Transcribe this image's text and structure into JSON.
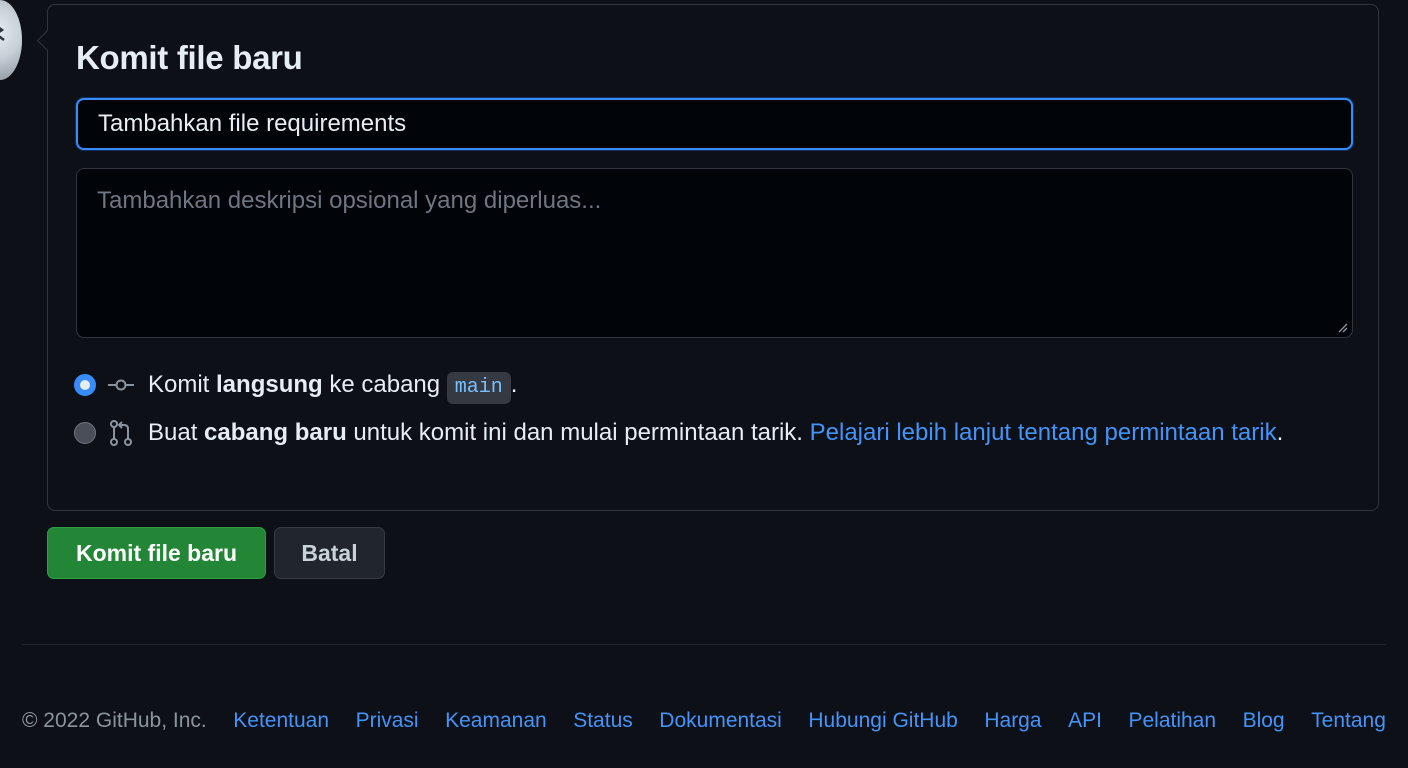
{
  "commit_form": {
    "heading": "Komit file baru",
    "summary_value": "Tambahkan file requirements",
    "description_placeholder": "Tambahkan deskripsi opsional yang diperluas...",
    "option_direct": {
      "prefix": "Komit ",
      "bold": "langsung",
      "middle": " ke cabang ",
      "branch": "main",
      "suffix": ".",
      "icon": "git-commit-icon",
      "selected": true
    },
    "option_new_branch": {
      "prefix": "Buat ",
      "bold": "cabang baru",
      "middle": " untuk komit ini dan mulai permintaan tarik. ",
      "link": "Pelajari lebih lanjut tentang permintaan tarik",
      "suffix": ".",
      "icon": "git-pull-request-icon",
      "selected": false
    }
  },
  "actions": {
    "commit_label": "Komit file baru",
    "cancel_label": "Batal"
  },
  "footer": {
    "copyright": "© 2022 GitHub, Inc.",
    "links": [
      "Ketentuan",
      "Privasi",
      "Keamanan",
      "Status",
      "Dokumentasi",
      "Hubungi GitHub",
      "Harga",
      "API",
      "Pelatihan",
      "Blog",
      "Tentang"
    ]
  },
  "colors": {
    "background": "#0d1117",
    "accent": "#388bfd",
    "link": "#4493f8",
    "primary_button": "#238636"
  }
}
